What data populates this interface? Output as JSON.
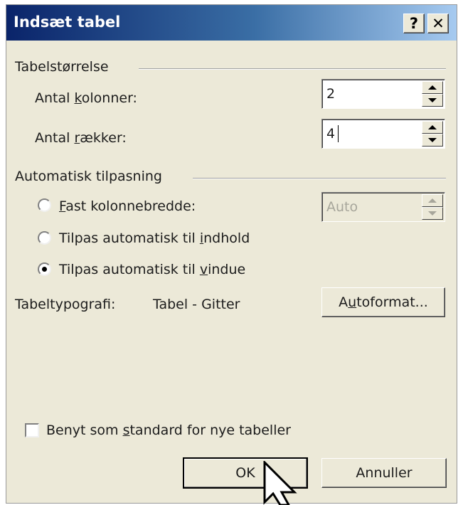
{
  "dialog": {
    "title": "Indsæt tabel",
    "help_label": "?",
    "close_label": "✕"
  },
  "table_size": {
    "group_label": "Tabelstørrelse",
    "columns": {
      "label_pre": "Antal ",
      "label_key": "k",
      "label_post": "olonner:",
      "value": "2"
    },
    "rows": {
      "label_pre": "Antal ",
      "label_key": "r",
      "label_post": "ækker:",
      "value": "4"
    }
  },
  "autofit": {
    "group_label": "Automatisk tilpasning",
    "fixed": {
      "label_key": "F",
      "label_post": "ast kolonnebredde:",
      "value": "Auto",
      "checked": false
    },
    "contents": {
      "label_pre": "Tilpas automatisk til ",
      "label_key": "i",
      "label_post": "ndhold",
      "checked": false
    },
    "window": {
      "label_pre": "Tilpas automatisk til ",
      "label_key": "v",
      "label_post": "indue",
      "checked": true
    }
  },
  "style": {
    "label": "Tabeltypografi:",
    "value": "Tabel - Gitter",
    "autoformat_pre": "A",
    "autoformat_key": "u",
    "autoformat_post": "toformat..."
  },
  "default_checkbox": {
    "label_pre": "Benyt som ",
    "label_key": "s",
    "label_post": "tandard for nye tabeller",
    "checked": false
  },
  "buttons": {
    "ok": "OK",
    "cancel": "Annuller"
  },
  "icons": {
    "help": "help-icon",
    "close": "close-icon",
    "cursor": "mouse-pointer-icon"
  },
  "colors": {
    "titlebar_start": "#0a246a",
    "titlebar_end": "#a6caf0",
    "dialog_bg": "#ece9d8"
  }
}
